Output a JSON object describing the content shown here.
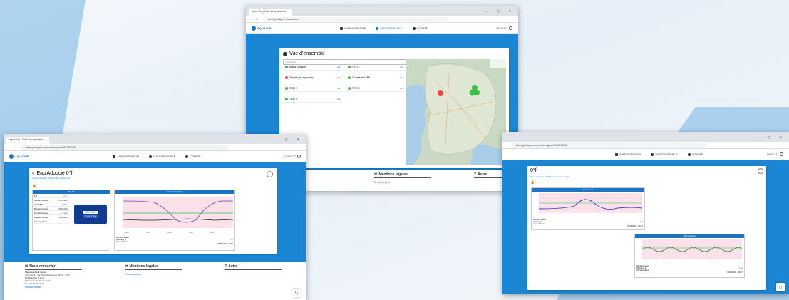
{
  "overview": {
    "tab_title": "Aqua Vue | Outil de supervision",
    "url": "client.guidage.com/overview",
    "logo": "AQUAVUE",
    "nav": [
      "ADMINISTRATION",
      "VUE D'ENSEMBLE",
      "COMPTE"
    ],
    "user": "DEMO123",
    "title": "Vue d'ensemble",
    "search_placeholder": "Recherche...",
    "sites": [
      {
        "name": "Maison Cosquer",
        "status": "ok",
        "link": "Voir"
      },
      {
        "name": "TEST 1",
        "status": "ok",
        "link": "Voir"
      },
      {
        "name": "Test (ne pas supprimer)",
        "status": "alarm",
        "link": "Voir"
      },
      {
        "name": "Ouillage test PBP",
        "status": "ok",
        "link": "Voir"
      },
      {
        "name": "TEST 2",
        "status": "ok",
        "link": "Voir"
      },
      {
        "name": "TEST 3",
        "status": "ok",
        "link": "Voir"
      },
      {
        "name": "TEST 4",
        "status": "ok",
        "link": "Voir"
      }
    ]
  },
  "detail_left": {
    "tab_title": "Aqua Vue | Outil de supervision",
    "url": "client.guidage.com/monitoring/site/8C9B0D58",
    "logo": "AQUAVUE",
    "nav": [
      "ADMINISTRATION",
      "VUE D'ENSEMBLE",
      "COMPTE"
    ],
    "user": "DEMO123",
    "title": "Eau Adoucie 0°f",
    "breadcrumb": "Vue d'ensemble / TEST 2 / Eau Adoucie 0°f",
    "panel_left_title": "TH 0°f",
    "rows": [
      {
        "label": "TH",
        "value": "0.0 °f"
      },
      {
        "label": "Dernière lecture",
        "value": "07/02/2021"
      },
      {
        "label": "Cap EPB",
        "value": "0.000 m³"
      },
      {
        "label": "Dernière lecture",
        "value": "07/02/2021"
      },
      {
        "label": "Fonctionnement",
        "value": "0.0 litres"
      },
      {
        "label": "Dernière lecture",
        "value": "07/02/2021"
      },
      {
        "label": "Commentaires",
        "value": ""
      }
    ],
    "device_lines": [
      "XXX XXX",
      "XXXX XX"
    ],
    "panel_right_title": "Intensité de l'Eau",
    "chart_footer_left": "Dernière valeur\nAlarme(s) le\nCommentaires",
    "chart_footer_right": "07/02/2021 - 09:17",
    "chart_footer_value": "0.0"
  },
  "detail_right": {
    "url": "client.guidage.com/monitoring/site/8C9B0D58",
    "nav": [
      "ADMINISTRATION",
      "VUE D'ENSEMBLE",
      "COMPTE"
    ],
    "user": "DEMO123",
    "title": "0°f",
    "breadcrumb": "Vue d'ensemble / TEST 2 / Eau Adoucie 0°f",
    "chart1_title": "Dureté TH",
    "chart1_value": "0.0",
    "chart1_date": "07/02/2021 - 09:17",
    "chart2_title": "Température",
    "chart2_value": "1.04",
    "chart2_date": "07/02/2021 - 09:17",
    "footer_labels": "Dernière valeur\nAlarme(s) le\nCommentaires"
  },
  "footer": {
    "contact_title": "Nous contacter",
    "company": "Siège social & usine",
    "address": "Adresse: Z.I. de Brest Technopole 29470 - 29 T. BOHRENNE France",
    "phone": "Téléphone: 02 98 44 12 17",
    "fax": "Fax: 02 98 44 12 18",
    "contact_link": "Nous contacter",
    "legal_title": "Mentions légales",
    "legal_link": "En savoir plus...",
    "other_title": "Autre..."
  },
  "colors": {
    "brand": "#1d74c0",
    "band": "#1b86d3",
    "ok": "#3cbf4a",
    "alarm": "#e04a3c"
  }
}
